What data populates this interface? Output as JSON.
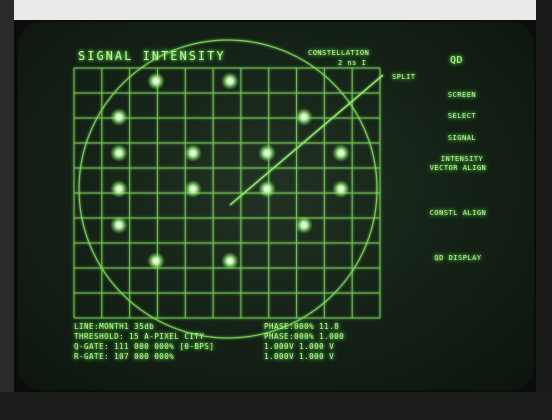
{
  "screen": {
    "title": "SIGNAL INTENSITY",
    "mode_header": "CONSTELLATION",
    "mode_value": "2 ns I"
  },
  "menu": {
    "mode_key": "QD",
    "split": "SPLIT",
    "items": [
      {
        "line1": "SCREEN",
        "line2": "SELECT"
      },
      {
        "line1": "SIGNAL",
        "line2": "INTENSITY"
      },
      {
        "line1": "VECTOR ALIGN",
        "line2": ""
      },
      {
        "line1": "CONSTL ALIGN",
        "line2": ""
      },
      {
        "line1": "QD DISPLAY",
        "line2": ""
      }
    ]
  },
  "status": {
    "line1_left": "LINE:MONTH1 35db",
    "line1_right": "PHASE:000% 11.8",
    "line2_left": "THRESHOLD: 15 A-PIXEL CITY",
    "line2_right": "PHASE:000% 1.000",
    "line3_left": "Q-GATE: 111 000 000% [0-BPS]",
    "line3_right": "1.000V 1.000 V",
    "line4_left": "R-GATE: 107 000 000%",
    "line4_right": "1.000V 1.000 V"
  },
  "colors": {
    "phosphor": "#bdf7a4",
    "trace": "#7fe05d",
    "dot": "#e8ffe0"
  },
  "constellation": [
    [
      -2,
      -3
    ],
    [
      0,
      -3
    ],
    [
      -3,
      -2
    ],
    [
      2,
      -2
    ],
    [
      -3,
      -1
    ],
    [
      -1,
      -1
    ],
    [
      1,
      -1
    ],
    [
      3,
      -1
    ],
    [
      -3,
      0
    ],
    [
      -1,
      0
    ],
    [
      1,
      0
    ],
    [
      3,
      0
    ],
    [
      -3,
      1
    ],
    [
      2,
      1
    ],
    [
      -2,
      2
    ],
    [
      0,
      2
    ]
  ]
}
